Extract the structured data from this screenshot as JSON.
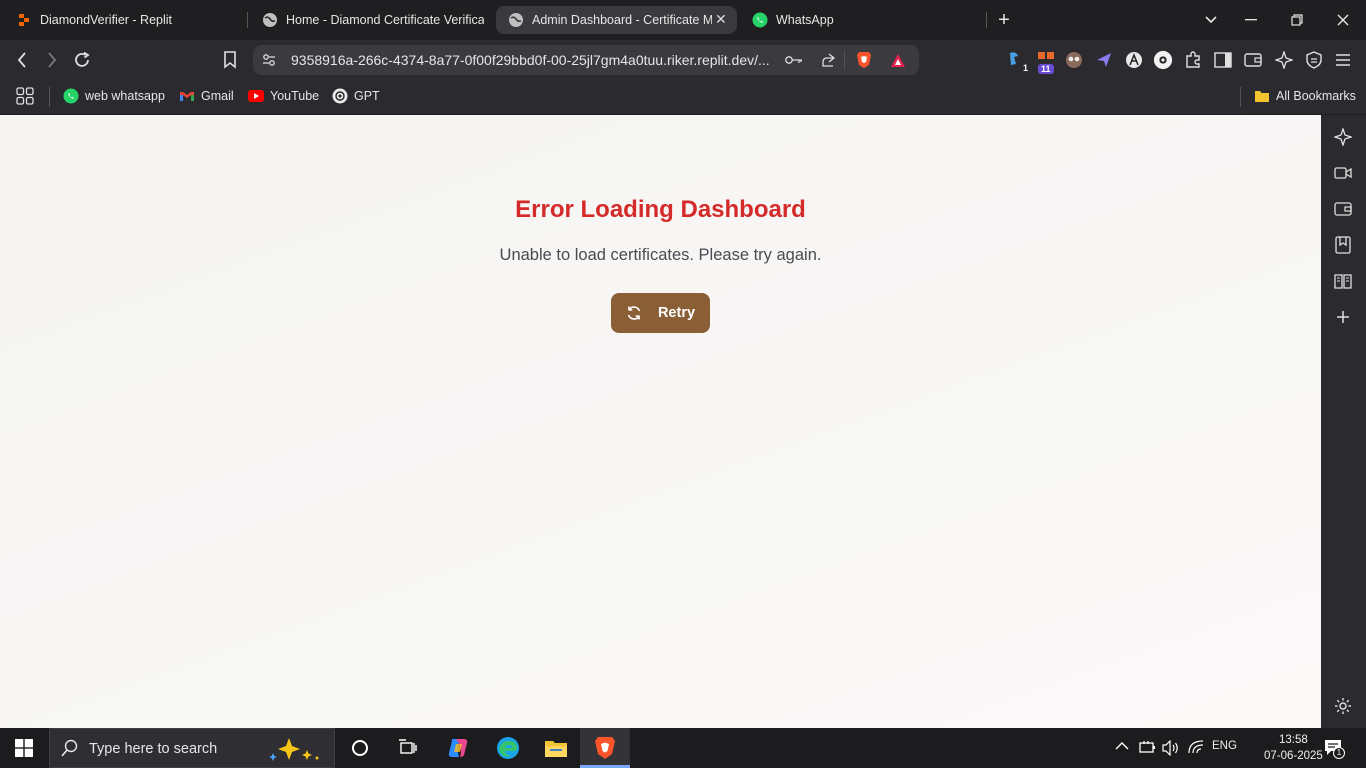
{
  "browser": {
    "tabs": [
      {
        "title": "DiamondVerifier - Replit",
        "active": false
      },
      {
        "title": "Home - Diamond Certificate Verificati",
        "active": false
      },
      {
        "title": "Admin Dashboard - Certificate M",
        "active": true
      },
      {
        "title": "WhatsApp",
        "active": false
      }
    ],
    "new_tab": "+",
    "url": "9358916a-266c-4374-8a77-0f00f29bbd0f-00-25jl7gm4a0tuu.riker.replit.dev/...",
    "extension_badges": {
      "first": "1",
      "second": "11"
    }
  },
  "bookmarks": {
    "items": [
      {
        "label": "web whatsapp",
        "icon": "whatsapp-icon"
      },
      {
        "label": "Gmail",
        "icon": "gmail-icon"
      },
      {
        "label": "YouTube",
        "icon": "youtube-icon"
      },
      {
        "label": "GPT",
        "icon": "openai-icon"
      }
    ],
    "all_bookmarks": "All Bookmarks"
  },
  "page": {
    "error_title": "Error Loading Dashboard",
    "error_message": "Unable to load certificates. Please try again.",
    "retry_label": "Retry"
  },
  "taskbar": {
    "search_placeholder": "Type here to search",
    "language": "ENG",
    "time": "13:58",
    "date": "07-06-2025",
    "notification_count": "1"
  },
  "colors": {
    "error": "#d42a2a",
    "retry_button": "#8a5f35",
    "page_bg": "#f7f6f4"
  }
}
